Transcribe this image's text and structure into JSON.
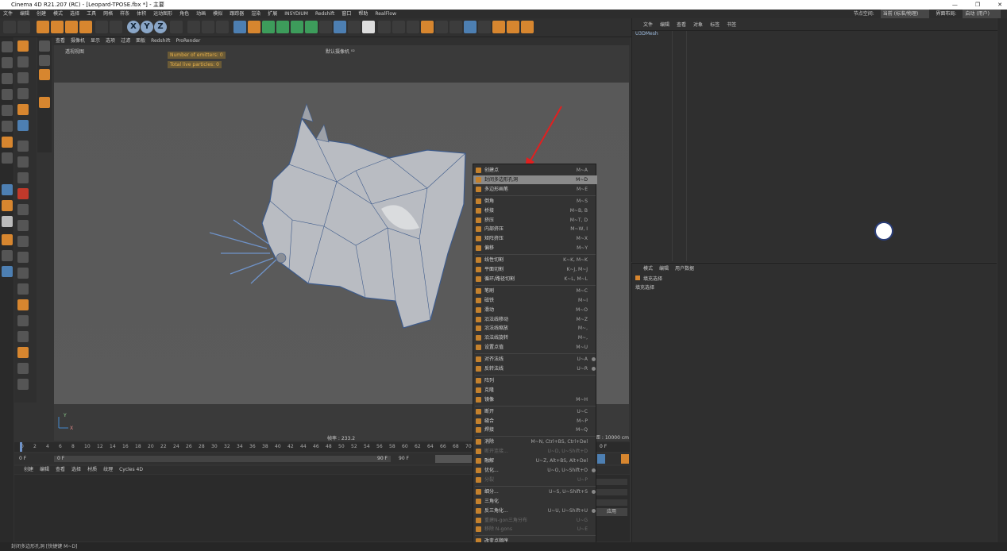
{
  "window": {
    "title": "Cinema 4D R21.207 (RC) - [Leopard-TPOSE.fbx *] - 主要",
    "controls": [
      "—",
      "❐",
      "✕"
    ]
  },
  "menubar": {
    "items": [
      "文件",
      "编辑",
      "创建",
      "模式",
      "选择",
      "工具",
      "网格",
      "样条",
      "体积",
      "运动图形",
      "角色",
      "动画",
      "模拟",
      "跟踪器",
      "渲染",
      "扩展",
      "INSYDIUM",
      "Redshift",
      "窗口",
      "帮助",
      "RealFlow"
    ],
    "layout_label": "界面布局:",
    "layout_value": "启动 (用户)",
    "node_label": "节点空间:",
    "node_value": "当前 (标准/物理)"
  },
  "viewport": {
    "menu": [
      "查看",
      "摄像机",
      "显示",
      "选项",
      "过滤",
      "面板",
      "Redshift",
      "ProRender"
    ],
    "name": "透视视图",
    "camera": "默认摄像机 ⁰²",
    "hud_emitters": "Number of emitters: 0",
    "hud_particles": "Total live particles: 0",
    "grid_spacing": "网格间距 : 10000 cm",
    "fps": "帧率 : 233.2"
  },
  "timeline": {
    "ticks": [
      "0",
      "2",
      "4",
      "6",
      "8",
      "10",
      "12",
      "14",
      "16",
      "18",
      "20",
      "22",
      "24",
      "26",
      "28",
      "30",
      "32",
      "34",
      "36",
      "38",
      "40",
      "42",
      "44",
      "46",
      "48",
      "50",
      "52",
      "54",
      "56",
      "58",
      "60",
      "62",
      "64",
      "66",
      "68",
      "70"
    ],
    "current_frame": "0 F",
    "start_frame": "0 F",
    "end_frame": "90 F",
    "max_frame": "90 F",
    "right_frame": "0 F"
  },
  "material_menu": [
    "创建",
    "编辑",
    "查看",
    "选择",
    "材质",
    "纹理",
    "Cycles 4D"
  ],
  "object_manager": {
    "menu": [
      "文件",
      "编辑",
      "查看",
      "对象",
      "标签",
      "书签"
    ],
    "object_name": "U3DMesh"
  },
  "attribute_manager": {
    "menu": [
      "模式",
      "编辑",
      "用户数据"
    ],
    "tool_title": "填充选择",
    "tool_sub": "填充选择",
    "apply_label": "应用"
  },
  "context_menu": {
    "items": [
      {
        "label": "创建点",
        "shortcut": "M~A",
        "state": "normal"
      },
      {
        "label": "封闭多边形孔洞",
        "shortcut": "M~D",
        "state": "highlight"
      },
      {
        "label": "多边形画笔",
        "shortcut": "M~E",
        "state": "normal"
      },
      {
        "sep": true
      },
      {
        "label": "倒角",
        "shortcut": "M~S",
        "state": "normal"
      },
      {
        "label": "桥接",
        "shortcut": "M~B, B",
        "state": "normal"
      },
      {
        "label": "挤压",
        "shortcut": "M~T, D",
        "state": "normal"
      },
      {
        "label": "内部挤压",
        "shortcut": "M~W, I",
        "state": "normal"
      },
      {
        "label": "矩阵挤压",
        "shortcut": "M~X",
        "state": "normal"
      },
      {
        "label": "偏移",
        "shortcut": "M~Y",
        "state": "normal"
      },
      {
        "sep": true
      },
      {
        "label": "线性切割",
        "shortcut": "K~K, M~K",
        "state": "normal"
      },
      {
        "label": "平面切割",
        "shortcut": "K~J, M~J",
        "state": "normal"
      },
      {
        "label": "循环/路径切割",
        "shortcut": "K~L, M~L",
        "state": "normal"
      },
      {
        "sep": true
      },
      {
        "label": "笔刷",
        "shortcut": "M~C",
        "state": "normal"
      },
      {
        "label": "磁铁",
        "shortcut": "M~I",
        "state": "normal"
      },
      {
        "label": "滑动",
        "shortcut": "M~O",
        "state": "normal"
      },
      {
        "label": "沿法线移动",
        "shortcut": "M~Z",
        "state": "normal"
      },
      {
        "label": "沿法线缩放",
        "shortcut": "M~,",
        "state": "normal"
      },
      {
        "label": "沿法线旋转",
        "shortcut": "M~,",
        "state": "normal"
      },
      {
        "label": "设置点值",
        "shortcut": "M~U",
        "state": "normal"
      },
      {
        "sep": true
      },
      {
        "label": "对齐法线",
        "shortcut": "U~A",
        "state": "normal",
        "gear": true
      },
      {
        "label": "反转法线",
        "shortcut": "U~R",
        "state": "normal",
        "gear": true
      },
      {
        "sep": true
      },
      {
        "label": "阵列",
        "shortcut": "",
        "state": "normal"
      },
      {
        "label": "克隆",
        "shortcut": "",
        "state": "normal"
      },
      {
        "label": "镜像",
        "shortcut": "M~H",
        "state": "normal"
      },
      {
        "sep": true
      },
      {
        "label": "断开",
        "shortcut": "U~C",
        "state": "normal"
      },
      {
        "label": "缝合",
        "shortcut": "M~P",
        "state": "normal"
      },
      {
        "label": "焊接",
        "shortcut": "M~Q",
        "state": "normal"
      },
      {
        "sep": true
      },
      {
        "label": "消除",
        "shortcut": "M~N, Ctrl+BS, Ctrl+Del",
        "state": "normal"
      },
      {
        "label": "断开连接...",
        "shortcut": "U~D, U~Shift+D",
        "state": "disabled"
      },
      {
        "label": "融解",
        "shortcut": "U~Z, Alt+BS, Alt+Del",
        "state": "normal"
      },
      {
        "label": "优化...",
        "shortcut": "U~O, U~Shift+O",
        "state": "normal",
        "gear": true
      },
      {
        "label": "分裂",
        "shortcut": "U~P",
        "state": "disabled"
      },
      {
        "sep": true
      },
      {
        "label": "细分...",
        "shortcut": "U~S, U~Shift+S",
        "state": "normal",
        "gear": true
      },
      {
        "label": "三角化",
        "shortcut": "",
        "state": "normal"
      },
      {
        "label": "反三角化...",
        "shortcut": "U~U, U~Shift+U",
        "state": "normal",
        "gear": true
      },
      {
        "label": "重建N-gon三角分布",
        "shortcut": "U~G",
        "state": "disabled"
      },
      {
        "label": "移除 N-gons",
        "shortcut": "U~E",
        "state": "disabled"
      },
      {
        "sep": true
      },
      {
        "label": "改变点顺序",
        "shortcut": "",
        "state": "normal"
      }
    ]
  },
  "statusbar": {
    "text": "封闭多边形孔洞 [快捷键 M~D]"
  },
  "colors": {
    "accent": "#d7862f",
    "highlight": "#8a8a8a",
    "arrow": "#e02020",
    "model": "#b9bcc2",
    "wire": "#3d5a8a"
  }
}
